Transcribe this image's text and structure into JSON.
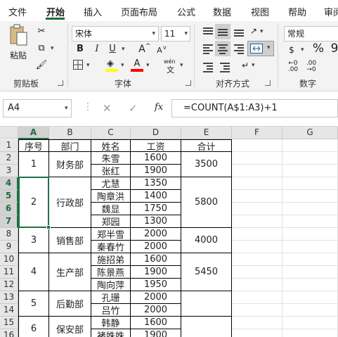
{
  "menu": {
    "tabs": [
      "文件",
      "开始",
      "插入",
      "页面布局",
      "公式",
      "数据",
      "视图",
      "帮助",
      "审阅"
    ]
  },
  "ribbon": {
    "clipboard": {
      "label": "剪贴板",
      "paste": "粘贴"
    },
    "font": {
      "label": "字体",
      "name": "宋体",
      "size": "11",
      "bold": "B",
      "italic": "I",
      "underline": "U",
      "grow": "A",
      "shrink": "A",
      "phonetic": "wén",
      "color_icon": "A",
      "highlight_color": "#ffff00",
      "font_color": "#ff0000"
    },
    "alignment": {
      "label": "对齐方式"
    },
    "number": {
      "label": "数字",
      "format": "常规",
      "percent": "%",
      "comma": "9"
    }
  },
  "formula_bar": {
    "name_box": "A4",
    "formula": "=COUNT(A$1:A3)+1",
    "fx": "fx"
  },
  "columns": [
    "A",
    "B",
    "C",
    "D",
    "E",
    "F",
    "G"
  ],
  "rows": [
    "1",
    "2",
    "3",
    "4",
    "5",
    "6",
    "7",
    "8",
    "9",
    "10",
    "11",
    "12",
    "13",
    "14",
    "15",
    "16"
  ],
  "sheet": {
    "headers": [
      "序号",
      "部门",
      "姓名",
      "工资",
      "合计"
    ],
    "groups": [
      {
        "no": "1",
        "dept": "财务部",
        "total": "3500",
        "staff": [
          [
            "朱雪",
            "1600"
          ],
          [
            "张红",
            "1900"
          ]
        ]
      },
      {
        "no": "2",
        "dept": "行政部",
        "total": "5800",
        "staff": [
          [
            "尤慧",
            "1350"
          ],
          [
            "陶章洪",
            "1400"
          ],
          [
            "魏显",
            "1750"
          ],
          [
            "郑园",
            "1300"
          ]
        ]
      },
      {
        "no": "3",
        "dept": "销售部",
        "total": "4000",
        "staff": [
          [
            "郑半雪",
            "2000"
          ],
          [
            "秦春竹",
            "2000"
          ]
        ]
      },
      {
        "no": "4",
        "dept": "生产部",
        "total": "5450",
        "staff": [
          [
            "施招弟",
            "1600"
          ],
          [
            "陈景燕",
            "1900"
          ],
          [
            "陶向萍",
            "1950"
          ]
        ]
      },
      {
        "no": "5",
        "dept": "后勤部",
        "total": "",
        "staff": [
          [
            "孔珊",
            "2000"
          ],
          [
            "吕竹",
            "2000"
          ]
        ]
      },
      {
        "no": "6",
        "dept": "保安部",
        "total": "",
        "staff": [
          [
            "韩静",
            "1600"
          ],
          [
            "褚姝姝",
            "1900"
          ]
        ]
      }
    ]
  }
}
